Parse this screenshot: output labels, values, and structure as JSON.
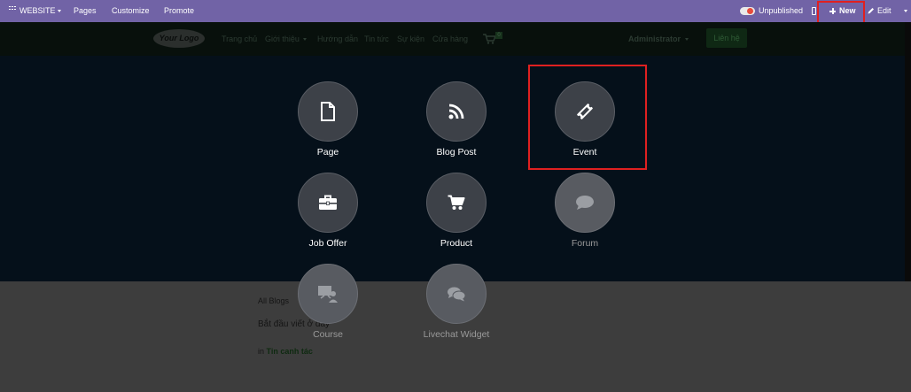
{
  "topbar": {
    "website_label": "WEBSITE",
    "menu": [
      "Pages",
      "Customize",
      "Promote"
    ],
    "unpublished_label": "Unpublished",
    "new_label": "New",
    "edit_label": "Edit"
  },
  "site": {
    "logo_text": "Your Logo",
    "nav": [
      "Trang chủ",
      "Giới thiệu",
      "Hướng dẫn",
      "Tin tức",
      "Sự kiện",
      "Cửa hàng"
    ],
    "cart_count": "0",
    "user": "Administrator",
    "contact_button": "Liên hệ"
  },
  "background": {
    "breadcrumb": "All Blogs",
    "intro_text": "Bắt đầu viết ở đây",
    "in_label": "in",
    "blog_name": "Tin canh tác"
  },
  "modules": [
    {
      "label": "Page",
      "icon": "page-icon"
    },
    {
      "label": "Blog Post",
      "icon": "rss-icon"
    },
    {
      "label": "Event",
      "icon": "ticket-icon"
    },
    {
      "label": "Job Offer",
      "icon": "briefcase-icon"
    },
    {
      "label": "Product",
      "icon": "cart-icon"
    },
    {
      "label": "Forum",
      "icon": "comment-icon"
    },
    {
      "label": "Course",
      "icon": "presentation-icon"
    },
    {
      "label": "Livechat Widget",
      "icon": "comments-icon"
    }
  ],
  "colors": {
    "topbar": "#7163a6",
    "highlight": "#e02020",
    "toggle_off": "#e74c3c"
  }
}
